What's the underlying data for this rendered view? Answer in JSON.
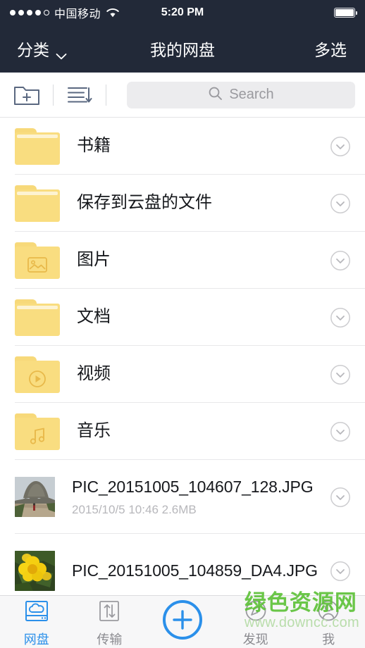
{
  "status_bar": {
    "signal_dots_filled": 4,
    "signal_dots_total": 5,
    "carrier": "中国移动",
    "wifi_icon": "wifi-icon",
    "time": "5:20 PM",
    "battery_icon": "battery-full-icon"
  },
  "nav_bar": {
    "left_label": "分类",
    "left_chevron_icon": "chevron-down-icon",
    "title": "我的网盘",
    "right_label": "多选",
    "background_color": "#222938"
  },
  "toolbar": {
    "new_folder_icon": "new-folder-icon",
    "sort_icon": "sort-icon",
    "search": {
      "icon": "search-icon",
      "placeholder": "Search",
      "value": ""
    }
  },
  "file_list": {
    "disclosure_icon": "chevron-down-circle-icon",
    "items": [
      {
        "name": "书籍",
        "type": "folder",
        "glyph": "folder-icon",
        "meta": ""
      },
      {
        "name": "保存到云盘的文件",
        "type": "folder",
        "glyph": "folder-icon",
        "meta": ""
      },
      {
        "name": "图片",
        "type": "folder",
        "glyph": "folder-image-icon",
        "meta": ""
      },
      {
        "name": "文档",
        "type": "folder",
        "glyph": "folder-icon",
        "meta": ""
      },
      {
        "name": "视频",
        "type": "folder",
        "glyph": "folder-video-icon",
        "meta": ""
      },
      {
        "name": "音乐",
        "type": "folder",
        "glyph": "folder-music-icon",
        "meta": ""
      },
      {
        "name": "PIC_20151005_104607_128.JPG",
        "type": "photo",
        "glyph": "photo-mountain-thumbnail",
        "meta": "2015/10/5 10:46 2.6MB"
      },
      {
        "name": "PIC_20151005_104859_DA4.JPG",
        "type": "photo",
        "glyph": "photo-flower-thumbnail",
        "meta": ""
      }
    ]
  },
  "tab_bar": {
    "accent_color": "#2b90ea",
    "items": [
      {
        "label": "网盘",
        "icon": "cloud-drive-icon",
        "active": true
      },
      {
        "label": "传输",
        "icon": "transfer-icon",
        "active": false
      },
      {
        "label": "",
        "icon": "add-circle-icon",
        "active": false
      },
      {
        "label": "发现",
        "icon": "compass-icon",
        "active": false
      },
      {
        "label": "我",
        "icon": "profile-icon",
        "active": false
      }
    ]
  },
  "watermark": {
    "site_name": "绿色资源网",
    "site_url": "www.downcc.com",
    "color": "#5fc23a"
  },
  "folder_colors": {
    "body": "#f9dd80",
    "tab": "#f7d97a",
    "strip": "#fdf3d2",
    "glyph": "#e8b94a"
  }
}
